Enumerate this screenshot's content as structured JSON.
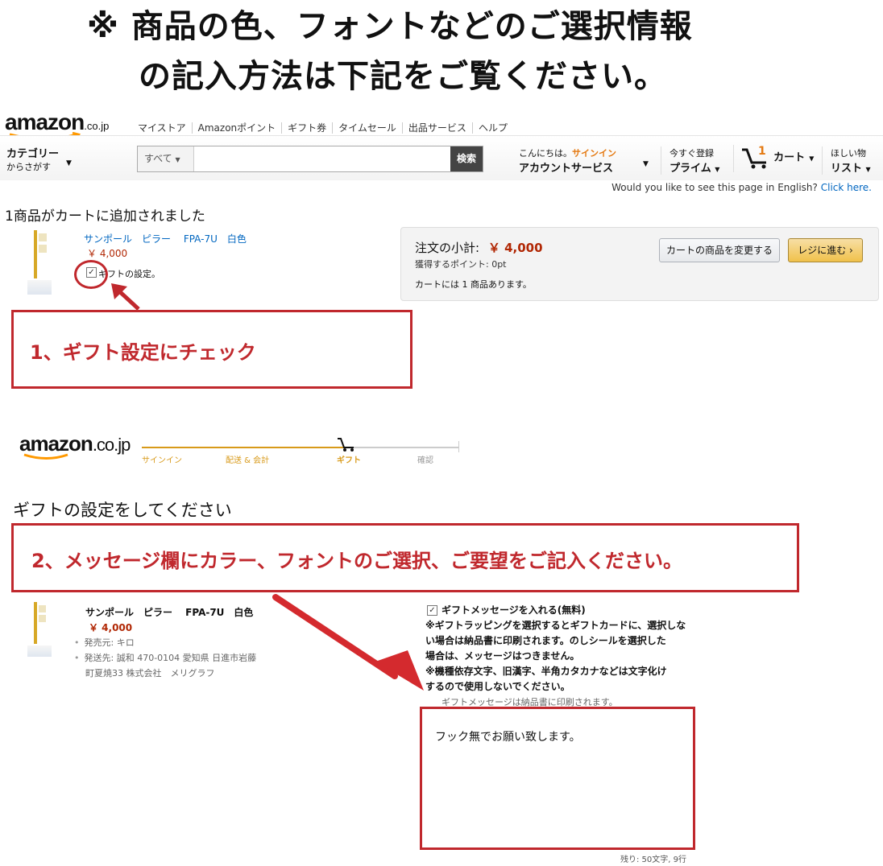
{
  "header": {
    "line1": "※ 商品の色、フォントなどのご選択情報",
    "line2": "の記入方法は下記をご覧ください。"
  },
  "navbar": {
    "logo": "amazon",
    "logo_suffix": ".co.jp",
    "links": [
      "マイストア",
      "Amazonポイント",
      "ギフト券",
      "タイムセール",
      "出品サービス",
      "ヘルプ"
    ],
    "category_line1": "カテゴリー",
    "category_line2": "からさがす",
    "search_scope": "すべて",
    "search_button": "検索",
    "greeting": "こんにちは。",
    "signin": "サインイン",
    "account": "アカウントサービス",
    "prime_line1": "今すぐ登録",
    "prime_line2": "プライム",
    "cart_count": "1",
    "cart_label": "カート",
    "wishlist_line1": "ほしい物",
    "wishlist_line2": "リスト",
    "english_prompt": "Would you like to see this page in English?",
    "english_link": "Click here."
  },
  "cart_section": {
    "heading": "1商品がカートに追加されました",
    "item_name": "サンポール　ピラー　 FPA-7U　白色",
    "item_price": "￥ 4,000",
    "gift_label": "ギフトの設定。",
    "subtotal_label": "注文の小計:",
    "subtotal_value": "￥ 4,000",
    "points": "獲得するポイント: 0pt",
    "cart_count_text": "カートには 1 商品あります。",
    "change_button": "カートの商品を変更する",
    "checkout_button": "レジに進む ›"
  },
  "step1": {
    "text": "1、ギフト設定にチェック"
  },
  "checkout_progress": {
    "logo": "amazon",
    "logo_suffix": ".co.jp",
    "steps": [
      "サインイン",
      "配送 & 会計",
      "ギフト",
      "確認"
    ]
  },
  "gift_section": {
    "heading": "ギフトの設定をしてください",
    "item_name": "サンポール　ピラー　 FPA-7U　白色",
    "item_price": "￥ 4,000",
    "seller": "発売元: キロ",
    "ship_to_line1": "発送先: 誠和 470-0104 愛知県 日進市岩藤",
    "ship_to_line2": "町夏焼33 株式会社　メリグラフ",
    "message_checkbox_label": "ギフトメッセージを入れる(無料)",
    "notes": [
      "※ギフトラッピングを選択するとギフトカードに、選択しな",
      "い場合は納品書に印刷されます。のしシールを選択した",
      "場合は、メッセージはつきません。",
      "※機種依存文字、旧漢字、半角カタカナなどは文字化け",
      "するので使用しないでください。"
    ],
    "print_note": "ギフトメッセージは納品書に印刷されます。",
    "message_value": "フック無でお願い致します。",
    "remaining": "残り: 50文字, 9行"
  },
  "step2": {
    "text": "2、メッセージ欄にカラー、フォントのご選択、ご要望をご記入ください。"
  },
  "colors": {
    "accent_red": "#c0282d",
    "price_red": "#b12704",
    "link_blue": "#0066c0",
    "amazon_orange": "#f90"
  }
}
